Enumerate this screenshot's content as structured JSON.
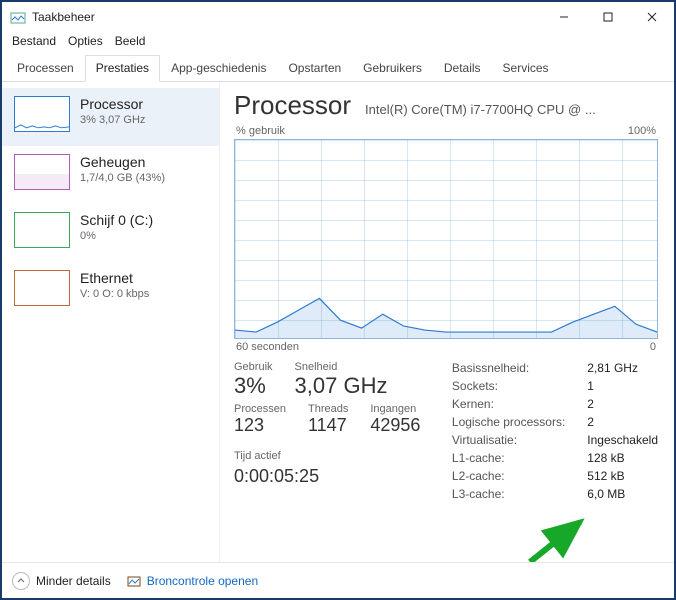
{
  "window": {
    "title": "Taakbeheer"
  },
  "menu": {
    "file": "Bestand",
    "options": "Opties",
    "view": "Beeld"
  },
  "tabs": {
    "processes": "Processen",
    "performance": "Prestaties",
    "app_history": "App-geschiedenis",
    "startup": "Opstarten",
    "users": "Gebruikers",
    "details": "Details",
    "services": "Services"
  },
  "sidebar": {
    "cpu": {
      "title": "Processor",
      "sub": "3% 3,07 GHz"
    },
    "mem": {
      "title": "Geheugen",
      "sub": "1,7/4,0 GB (43%)"
    },
    "disk": {
      "title": "Schijf 0 (C:)",
      "sub": "0%"
    },
    "eth": {
      "title": "Ethernet",
      "sub": "V: 0 O: 0 kbps"
    }
  },
  "header": {
    "title": "Processor",
    "model": "Intel(R) Core(TM) i7-7700HQ CPU @ ..."
  },
  "chart": {
    "y_label": "% gebruik",
    "y_max": "100%",
    "x_left": "60 seconden",
    "x_right": "0"
  },
  "stats": {
    "usage_label": "Gebruik",
    "usage_value": "3%",
    "speed_label": "Snelheid",
    "speed_value": "3,07 GHz",
    "processes_label": "Processen",
    "processes_value": "123",
    "threads_label": "Threads",
    "threads_value": "1147",
    "handles_label": "Ingangen",
    "handles_value": "42956",
    "uptime_label": "Tijd actief",
    "uptime_value": "0:00:05:25"
  },
  "right_stats": {
    "base_speed_k": "Basissnelheid:",
    "base_speed_v": "2,81 GHz",
    "sockets_k": "Sockets:",
    "sockets_v": "1",
    "cores_k": "Kernen:",
    "cores_v": "2",
    "logical_k": "Logische processors:",
    "logical_v": "2",
    "virt_k": "Virtualisatie:",
    "virt_v": "Ingeschakeld",
    "l1_k": "L1-cache:",
    "l1_v": "128 kB",
    "l2_k": "L2-cache:",
    "l2_v": "512 kB",
    "l3_k": "L3-cache:",
    "l3_v": "6,0 MB"
  },
  "bottom": {
    "fewer": "Minder details",
    "resmon": "Broncontrole openen"
  },
  "chart_data": {
    "type": "line",
    "title": "% gebruik",
    "xlabel": "seconden",
    "ylabel": "% gebruik",
    "ylim": [
      0,
      100
    ],
    "xlim_label": [
      "60 seconden",
      "0"
    ],
    "x": [
      60,
      57,
      54,
      51,
      48,
      45,
      42,
      39,
      36,
      33,
      30,
      27,
      24,
      21,
      18,
      15,
      12,
      9,
      6,
      3,
      0
    ],
    "values": [
      4,
      3,
      8,
      14,
      20,
      9,
      5,
      12,
      6,
      4,
      3,
      3,
      3,
      3,
      3,
      3,
      8,
      12,
      16,
      7,
      3
    ]
  }
}
